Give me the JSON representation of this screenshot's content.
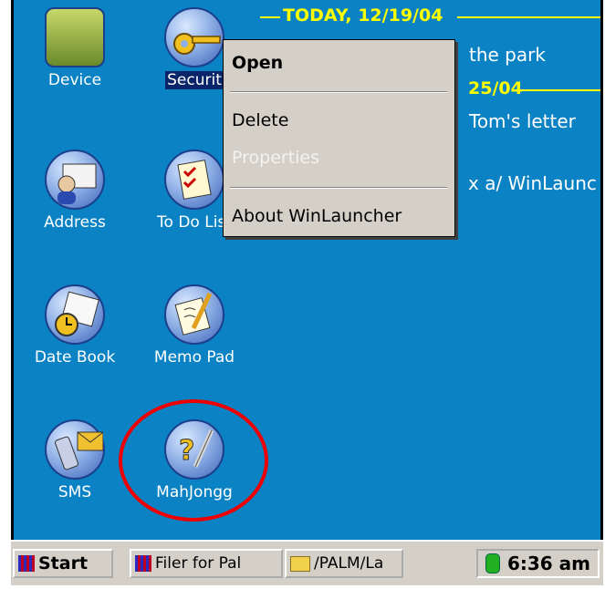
{
  "desktop": {
    "icons": [
      {
        "label": "Device",
        "icon": "device-icon",
        "selected": false
      },
      {
        "label": "Securit",
        "icon": "security-key-icon",
        "selected": true
      },
      {
        "label": "Address",
        "icon": "address-icon",
        "selected": false
      },
      {
        "label": "To Do List",
        "icon": "todo-list-icon",
        "selected": false
      },
      {
        "label": "Date Book",
        "icon": "datebook-icon",
        "selected": false
      },
      {
        "label": "Memo Pad",
        "icon": "memopad-icon",
        "selected": false
      },
      {
        "label": "SMS",
        "icon": "sms-icon",
        "selected": false
      },
      {
        "label": "MahJongg",
        "icon": "mahjongg-icon",
        "selected": false
      }
    ]
  },
  "schedule": {
    "today_header": "TODAY, 12/19/04",
    "item1": "the park",
    "date2_header": "25/04",
    "item2": "Tom's letter",
    "item3": "x a/ WinLaunc"
  },
  "context_menu": {
    "items": [
      "Open",
      "Delete",
      "Properties",
      "About WinLauncher"
    ],
    "disabled": [
      "Properties"
    ]
  },
  "taskbar": {
    "start": "Start",
    "task1": "Filer for Pal",
    "task2": "/PALM/La",
    "clock": "6:36 am"
  },
  "colors": {
    "desktop_bg": "#0a82c4",
    "accent_yellow": "#ffff00",
    "highlight_circle": "#e00000",
    "menu_bg": "#d4d0c8"
  }
}
